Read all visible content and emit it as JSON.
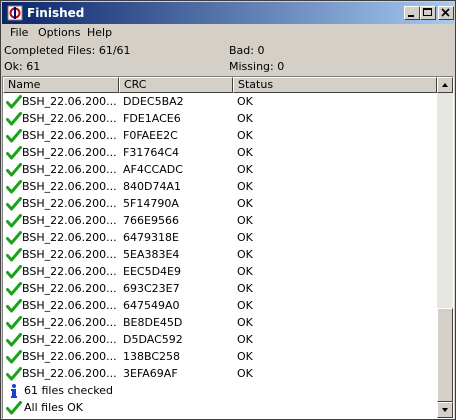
{
  "window": {
    "title": "Finished"
  },
  "menu": {
    "items": [
      "File",
      "Options",
      "Help"
    ]
  },
  "info": {
    "completed": "Completed Files: 61/61",
    "bad": "Bad: 0",
    "ok": "Ok: 61",
    "missing": "Missing: 0"
  },
  "columns": [
    "Name",
    "CRC",
    "Status"
  ],
  "rows": [
    {
      "name": "BSH_22.06.200...",
      "crc": "DDEC5BA2",
      "status": "OK"
    },
    {
      "name": "BSH_22.06.200...",
      "crc": "FDE1ACE6",
      "status": "OK"
    },
    {
      "name": "BSH_22.06.200...",
      "crc": "F0FAEE2C",
      "status": "OK"
    },
    {
      "name": "BSH_22.06.200...",
      "crc": "F31764C4",
      "status": "OK"
    },
    {
      "name": "BSH_22.06.200...",
      "crc": "AF4CCADC",
      "status": "OK"
    },
    {
      "name": "BSH_22.06.200...",
      "crc": "840D74A1",
      "status": "OK"
    },
    {
      "name": "BSH_22.06.200...",
      "crc": "5F14790A",
      "status": "OK"
    },
    {
      "name": "BSH_22.06.200...",
      "crc": "766E9566",
      "status": "OK"
    },
    {
      "name": "BSH_22.06.200...",
      "crc": "6479318E",
      "status": "OK"
    },
    {
      "name": "BSH_22.06.200...",
      "crc": "5EA383E4",
      "status": "OK"
    },
    {
      "name": "BSH_22.06.200...",
      "crc": "EEC5D4E9",
      "status": "OK"
    },
    {
      "name": "BSH_22.06.200...",
      "crc": "693C23E7",
      "status": "OK"
    },
    {
      "name": "BSH_22.06.200...",
      "crc": "647549A0",
      "status": "OK"
    },
    {
      "name": "BSH_22.06.200...",
      "crc": "BE8DE45D",
      "status": "OK"
    },
    {
      "name": "BSH_22.06.200...",
      "crc": "D5DAC592",
      "status": "OK"
    },
    {
      "name": "BSH_22.06.200...",
      "crc": "138BC258",
      "status": "OK"
    },
    {
      "name": "BSH_22.06.200...",
      "crc": "3EFA69AF",
      "status": "OK"
    }
  ],
  "summary": [
    {
      "icon": "info-icon",
      "text": "61 files checked"
    },
    {
      "icon": "check-icon",
      "text": "All files OK"
    }
  ],
  "colors": {
    "check": "#1aa31a",
    "info": "#1b3fd0",
    "titlebar_start": "#0a246a",
    "titlebar_end": "#a6caf0"
  }
}
